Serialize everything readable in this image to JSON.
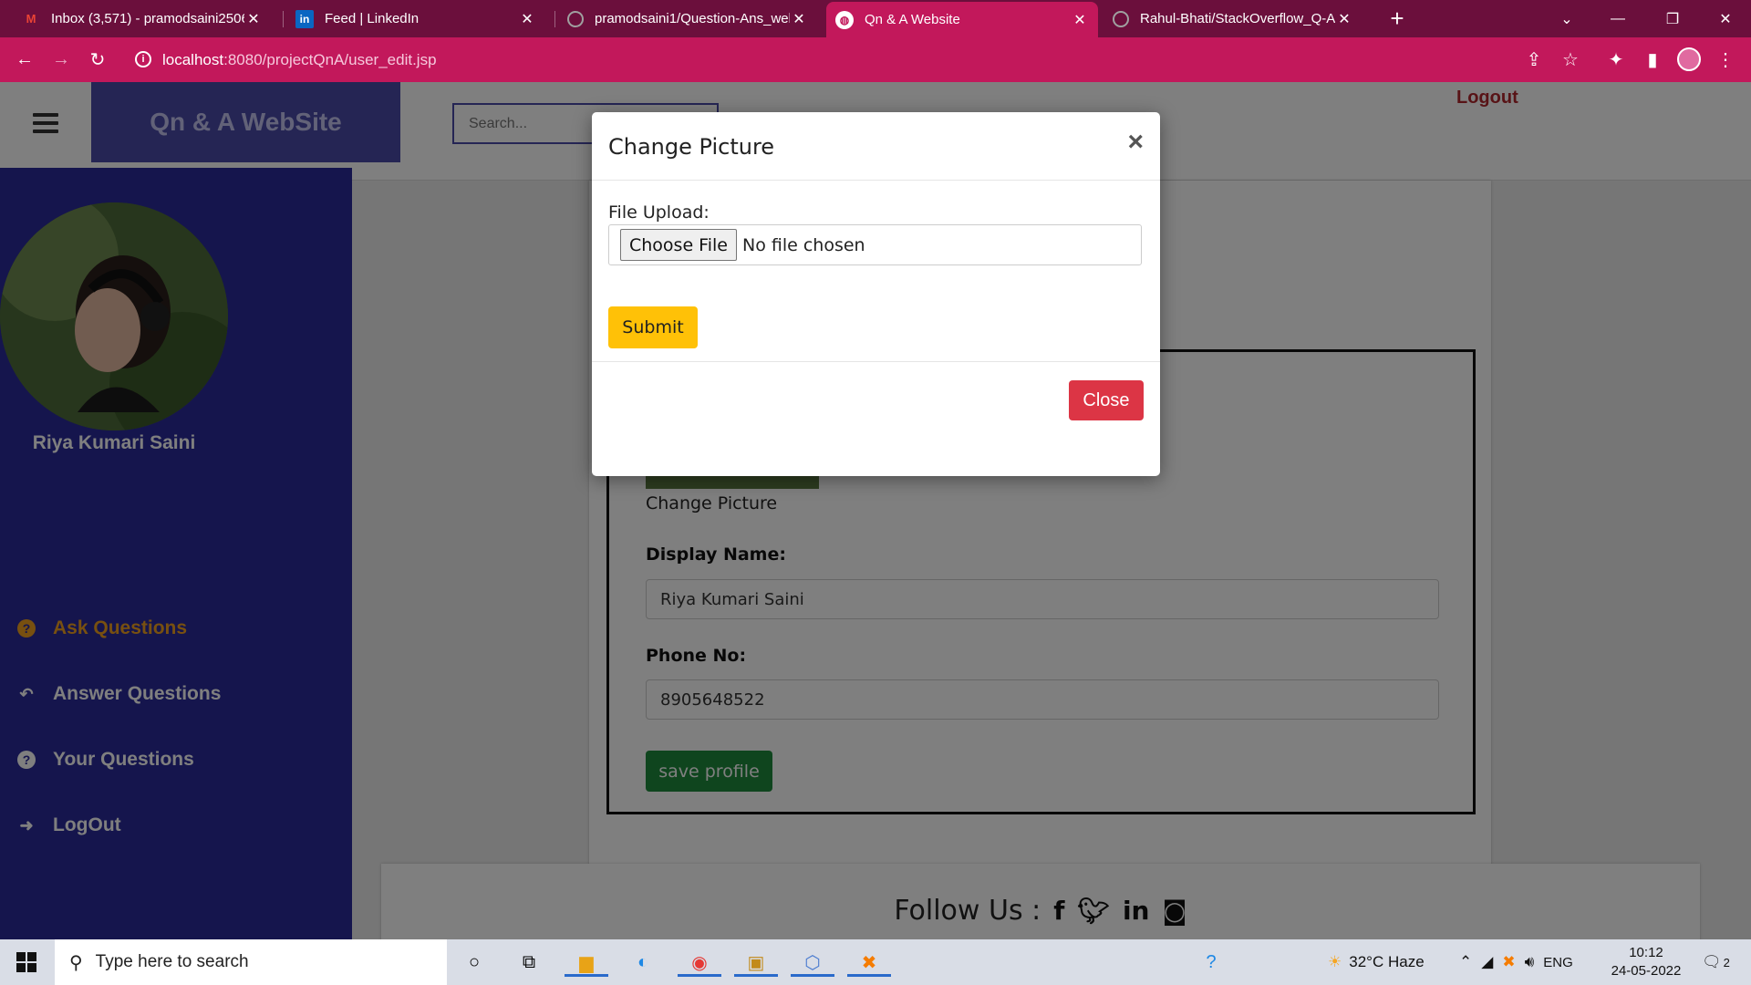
{
  "browser": {
    "tabs": [
      {
        "label": "Inbox (3,571) - pramodsaini2506",
        "icon": "gmail-icon"
      },
      {
        "label": "Feed | LinkedIn",
        "icon": "linkedin-icon"
      },
      {
        "label": "pramodsaini1/Question-Ans_wel",
        "icon": "github-icon"
      },
      {
        "label": "Qn & A Website",
        "icon": "globe-icon"
      },
      {
        "label": "Rahul-Bhati/StackOverflow_Q-A_",
        "icon": "github-icon"
      }
    ],
    "url_host": "localhost",
    "url_path": ":8080/projectQnA/user_edit.jsp"
  },
  "header": {
    "brand": "Qn & A WebSite",
    "search_placeholder": "Search...",
    "logout_label": "Logout"
  },
  "sidebar": {
    "user_name": "Riya Kumari Saini",
    "items": [
      {
        "label": "Ask Questions",
        "icon": "question-circle-icon"
      },
      {
        "label": "Answer Questions",
        "icon": "reply-icon"
      },
      {
        "label": "Your Questions",
        "icon": "question-circle-icon"
      },
      {
        "label": "LogOut",
        "icon": "sign-out-icon"
      }
    ]
  },
  "profile_form": {
    "change_picture_label": "Change Picture",
    "display_name_label": "Display Name:",
    "display_name_value": "Riya Kumari Saini",
    "phone_label": "Phone No:",
    "phone_value": "8905648522",
    "save_label": "save profile"
  },
  "footer": {
    "follow_label": "Follow Us :"
  },
  "modal": {
    "title": "Change Picture",
    "file_upload_label": "File Upload:",
    "choose_file_label": "Choose File",
    "file_status": "No file chosen",
    "submit_label": "Submit",
    "close_label": "Close"
  },
  "taskbar": {
    "search_placeholder": "Type here to search",
    "weather": "32°C  Haze",
    "language": "ENG",
    "time": "10:12",
    "date": "24-05-2022",
    "notifications": "2"
  },
  "colors": {
    "tab_bar": "#6b0f3c",
    "accent": "#c2185b",
    "sidebar": "#2b2b9a",
    "brand_bg": "#4a4aa8",
    "submit": "#ffc107",
    "close": "#dc3545",
    "save": "#1f8a3c"
  }
}
